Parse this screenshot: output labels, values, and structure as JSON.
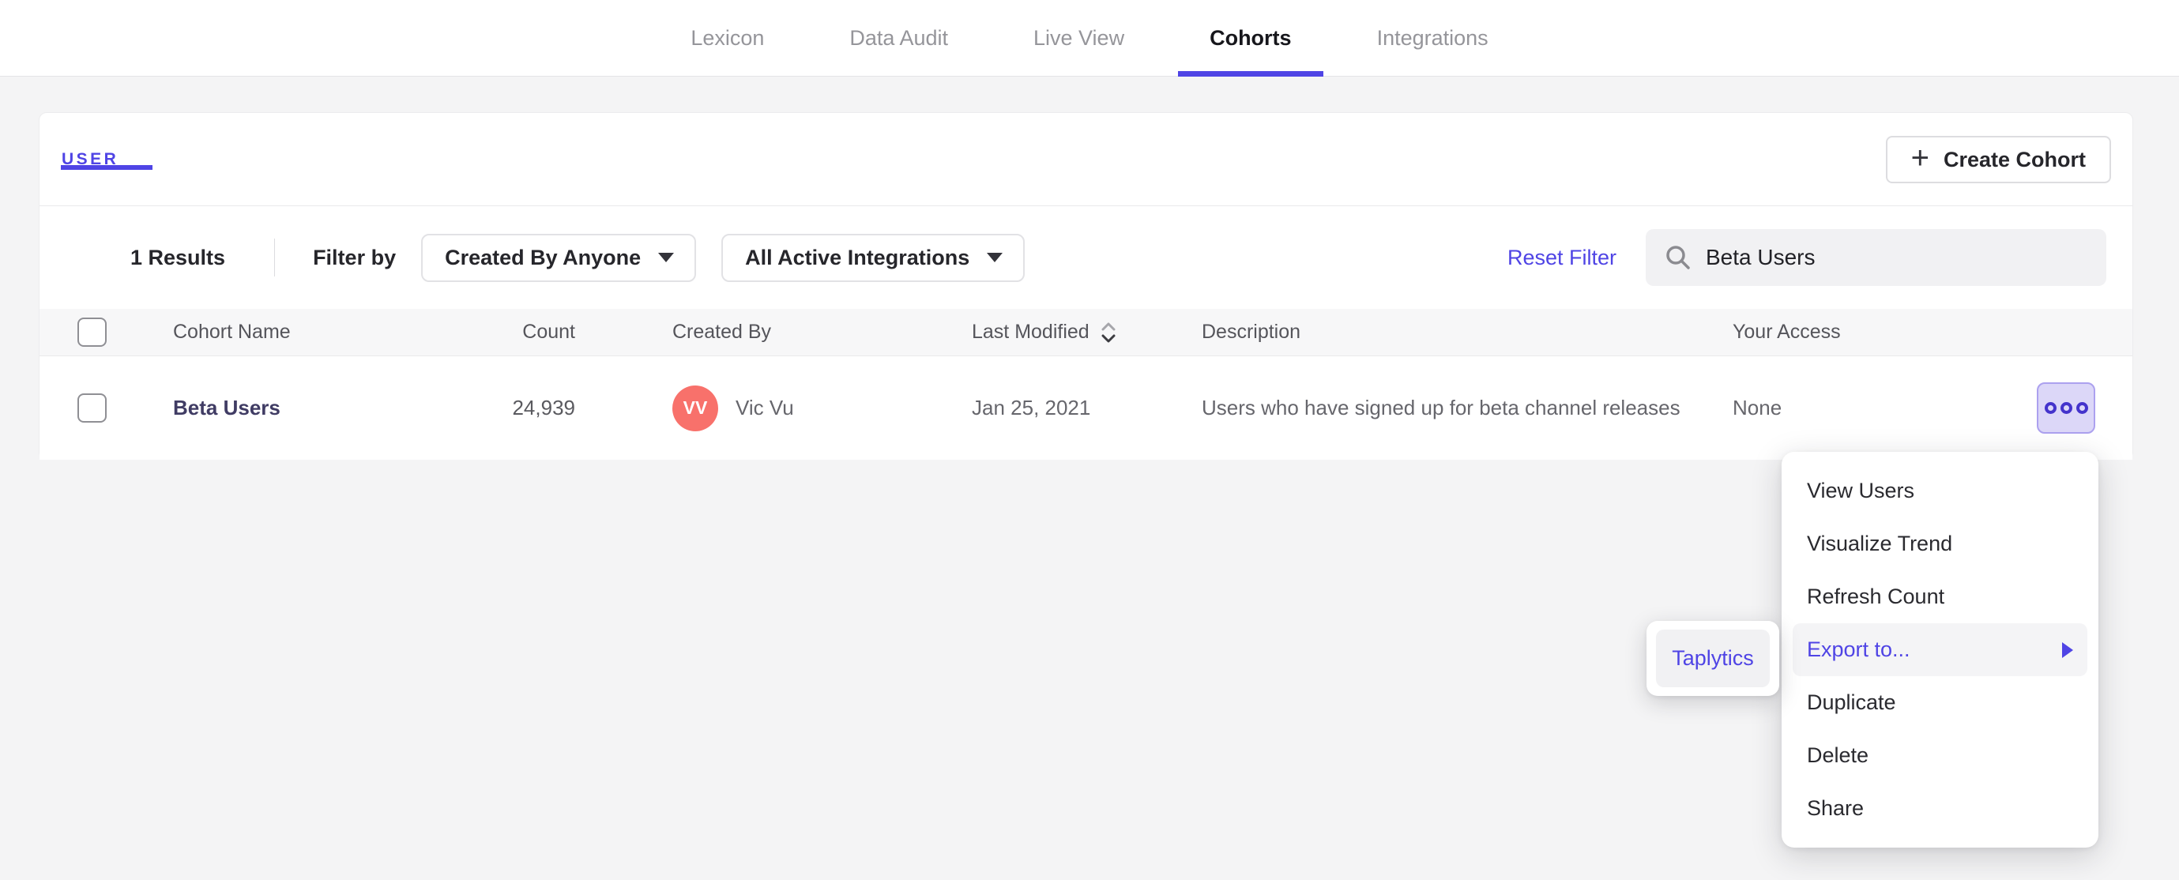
{
  "nav": {
    "items": [
      {
        "label": "Lexicon",
        "active": false
      },
      {
        "label": "Data Audit",
        "active": false
      },
      {
        "label": "Live View",
        "active": false
      },
      {
        "label": "Cohorts",
        "active": true
      },
      {
        "label": "Integrations",
        "active": false
      }
    ]
  },
  "cohorts_card": {
    "tab_label": "USER",
    "create_button": {
      "icon": "+",
      "label": "Create Cohort"
    },
    "filters": {
      "results_count": "1 Results",
      "filter_by_label": "Filter by",
      "created_by_dropdown": "Created By Anyone",
      "integrations_dropdown": "All Active Integrations",
      "reset_filter_label": "Reset Filter",
      "search": {
        "value": "Beta Users",
        "icon": "search-icon"
      }
    }
  },
  "table": {
    "headers": {
      "name": "Cohort Name",
      "count": "Count",
      "created_by": "Created By",
      "last_modified": "Last Modified",
      "description": "Description",
      "access": "Your Access"
    },
    "sorted_column": "Last Modified",
    "rows": [
      {
        "name": "Beta Users",
        "count": "24,939",
        "avatar_initials": "VV",
        "created_by": "Vic Vu",
        "last_modified": "Jan 25, 2021",
        "description": "Users who have signed up for beta channel releases",
        "access": "None"
      }
    ]
  },
  "context_menu": {
    "items": [
      {
        "label": "View Users"
      },
      {
        "label": "Visualize Trend"
      },
      {
        "label": "Refresh Count"
      },
      {
        "label": "Export to...",
        "highlighted": true,
        "has_submenu": true
      },
      {
        "label": "Duplicate"
      },
      {
        "label": "Delete"
      },
      {
        "label": "Share"
      }
    ]
  },
  "export_submenu": {
    "items": [
      {
        "label": "Taplytics"
      }
    ]
  },
  "colors": {
    "accent_purple": "#4f44e5",
    "avatar_red": "#f8716b",
    "page_background": "#f4f4f5",
    "menu_highlight": "#f4f4f6",
    "ellipsis_button_bg": "#dcd7f8",
    "ellipsis_button_border": "#aca1ef"
  }
}
